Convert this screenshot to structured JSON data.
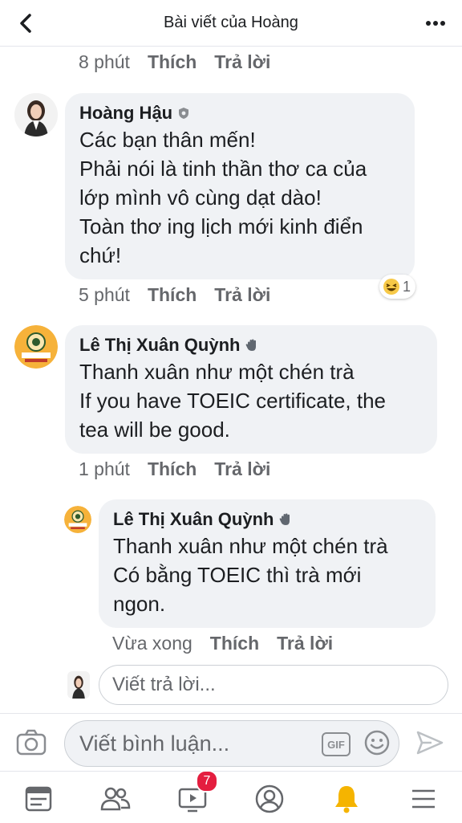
{
  "header": {
    "title": "Bài viết của Hoàng"
  },
  "comments": [
    {
      "time": "8 phút",
      "like": "Thích",
      "reply": "Trả lời"
    },
    {
      "name": "Hoàng Hậu",
      "lines": [
        "Các bạn thân mến!",
        "Phải nói là tinh thần thơ ca của",
        "lớp mình vô cùng dạt dào!",
        "Toàn thơ ing lịch mới kinh điển",
        "chứ!"
      ],
      "time": "5 phút",
      "like": "Thích",
      "reply": "Trả lời",
      "reaction": {
        "icon": "laughing-emoji",
        "count": "1"
      }
    },
    {
      "name": "Lê Thị Xuân Quỳnh",
      "lines": [
        "Thanh xuân như một chén trà",
        "If you have TOEIC certificate, the",
        "tea will be good."
      ],
      "time": "1 phút",
      "like": "Thích",
      "reply": "Trả lời"
    },
    {
      "name": "Lê Thị Xuân Quỳnh",
      "lines": [
        "Thanh xuân như một chén trà",
        "Có bằng TOEIC thì trà mới",
        "ngon."
      ],
      "time": "Vừa xong",
      "like": "Thích",
      "reply": "Trả lời"
    }
  ],
  "reply_box": {
    "placeholder": "Viết trả lời..."
  },
  "composer": {
    "placeholder": "Viết bình luận...",
    "gif_label": "GIF"
  },
  "tabbar": {
    "badge": "7"
  },
  "colors": {
    "bubble": "#f0f2f5",
    "meta": "#65676b",
    "badge": "#e41e3f",
    "bell": "#f5b400"
  }
}
